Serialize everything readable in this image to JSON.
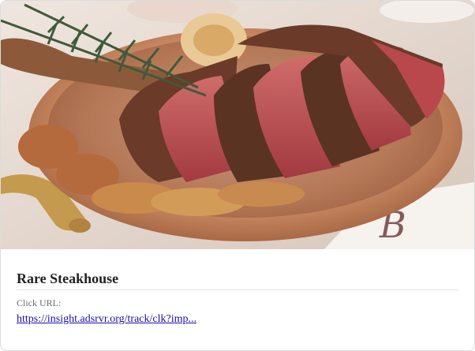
{
  "card": {
    "image_subject": "steak-in-copper-pan-image",
    "title": "Rare Steakhouse",
    "click_url_label": "Click URL:",
    "click_url": "https://insight.adsrvr.org/track/clk?imp..."
  },
  "colors": {
    "link": "#1a0dab",
    "title": "#222222",
    "label": "#6b6b6b",
    "copper": "#c98a62",
    "steak_crust": "#5a3323",
    "steak_rare": "#b8484b"
  }
}
